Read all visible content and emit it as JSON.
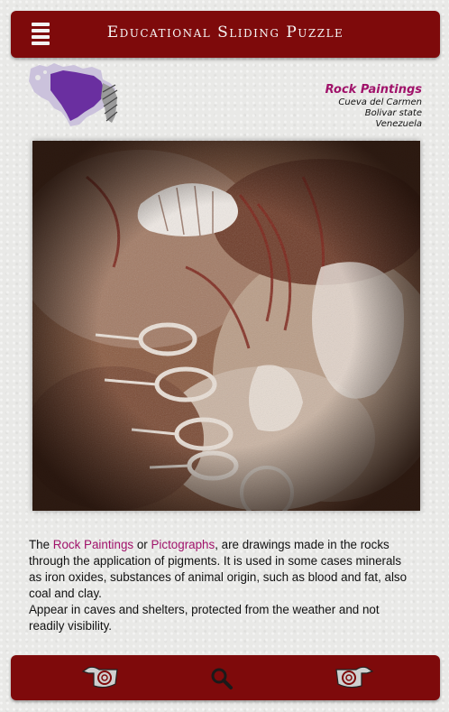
{
  "header": {
    "title": "Educational Sliding Puzzle",
    "menu_icon": "hamburger-menu-icon"
  },
  "info": {
    "subject": "Rock Paintings",
    "location": "Cueva del Carmen",
    "state": "Bolivar state",
    "country": "Venezuela"
  },
  "description": {
    "p1_before": "The ",
    "term1": "Rock Paintings",
    "p1_or": " or ",
    "term2": "Pictographs",
    "p1_after": ", are drawings made in the rocks through the application of pigments. It is used in some cases minerals as iron oxides, substances of animal origin, such as blood and fat, also coal and clay.",
    "p2": "Appear in caves and shelters, protected from the weather and not readily visibility."
  },
  "footer": {
    "left_icon": "pointing-hand-left-icon",
    "center_icon": "magnifier-icon",
    "right_icon": "pointing-hand-right-icon"
  },
  "colors": {
    "bar": "#7e0a0b",
    "accent": "#a0126a",
    "map_highlight": "#6a2fa0"
  }
}
